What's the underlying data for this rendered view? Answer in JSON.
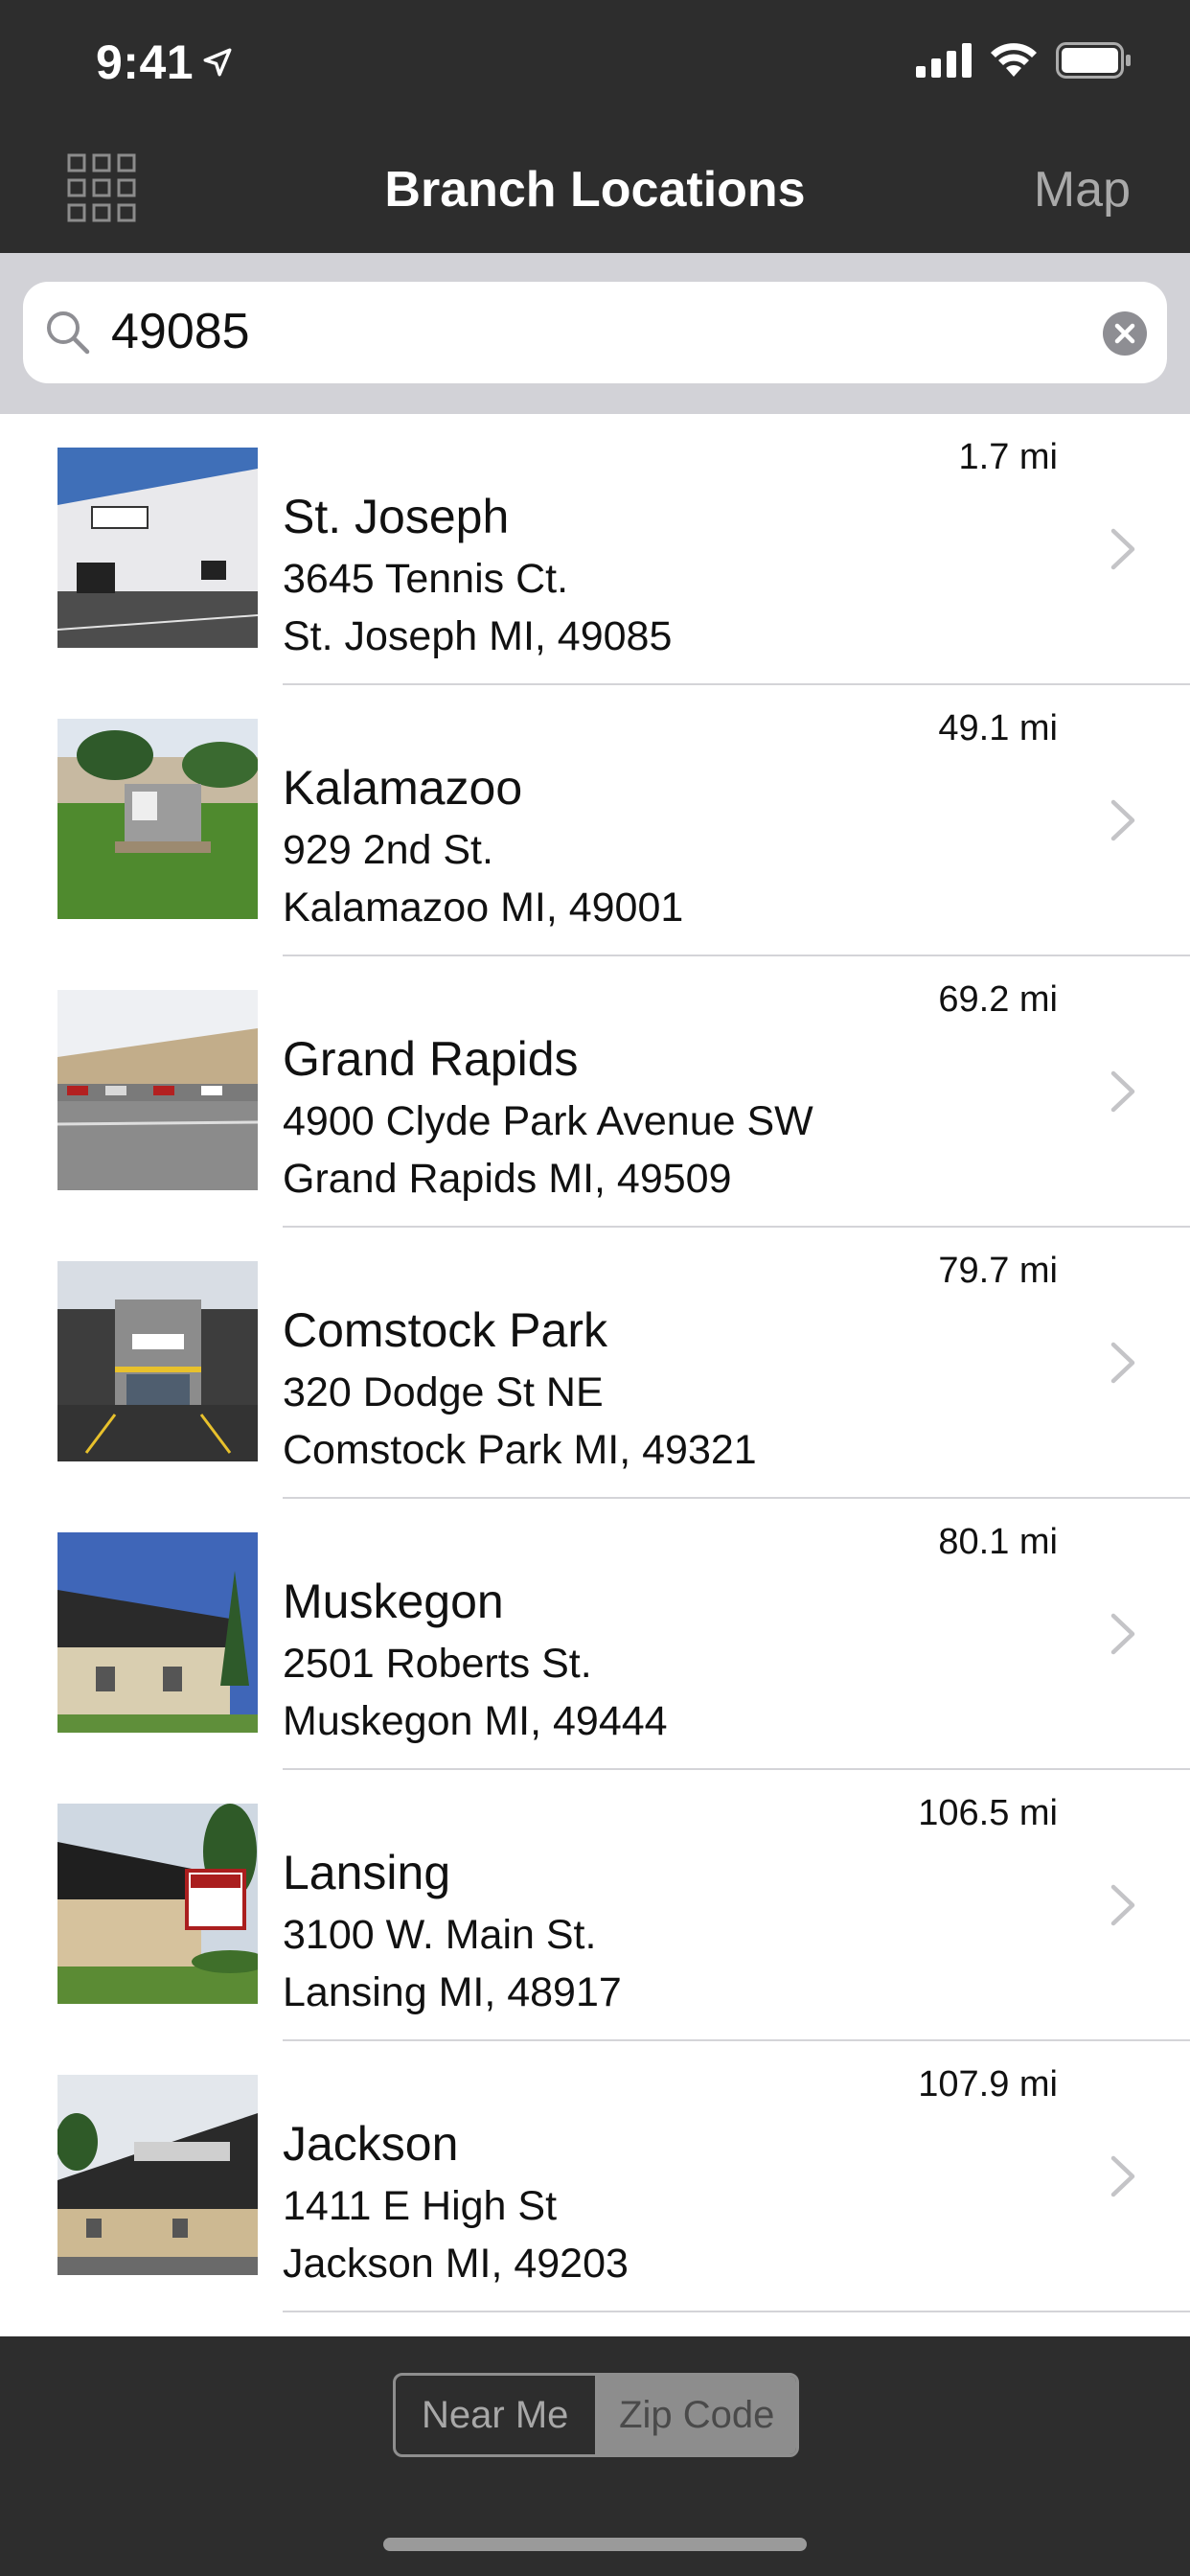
{
  "status_bar": {
    "time": "9:41"
  },
  "header": {
    "title": "Branch Locations",
    "map_label": "Map"
  },
  "search": {
    "value": "49085"
  },
  "locations": [
    {
      "name": "St. Joseph",
      "street": "3645 Tennis Ct.",
      "city": "St. Joseph MI, 49085",
      "distance": "1.7 mi"
    },
    {
      "name": "Kalamazoo",
      "street": "929 2nd St.",
      "city": "Kalamazoo MI, 49001",
      "distance": "49.1 mi"
    },
    {
      "name": "Grand Rapids",
      "street": "4900 Clyde Park Avenue SW",
      "city": "Grand Rapids MI, 49509",
      "distance": "69.2 mi"
    },
    {
      "name": "Comstock Park",
      "street": "320 Dodge St NE",
      "city": "Comstock Park MI, 49321",
      "distance": "79.7 mi"
    },
    {
      "name": "Muskegon",
      "street": "2501 Roberts St.",
      "city": "Muskegon MI, 49444",
      "distance": "80.1 mi"
    },
    {
      "name": "Lansing",
      "street": "3100 W. Main St.",
      "city": "Lansing MI, 48917",
      "distance": "106.5 mi"
    },
    {
      "name": "Jackson",
      "street": "1411 E High St",
      "city": "Jackson MI, 49203",
      "distance": "107.9 mi"
    }
  ],
  "segmented": {
    "near_me": "Near Me",
    "zip_code": "Zip Code",
    "selected": "Zip Code"
  },
  "colors": {
    "header_bg": "#2d2d2d",
    "search_bar_bg": "#d2d2d7",
    "segment_active": "#8d8d8d"
  }
}
